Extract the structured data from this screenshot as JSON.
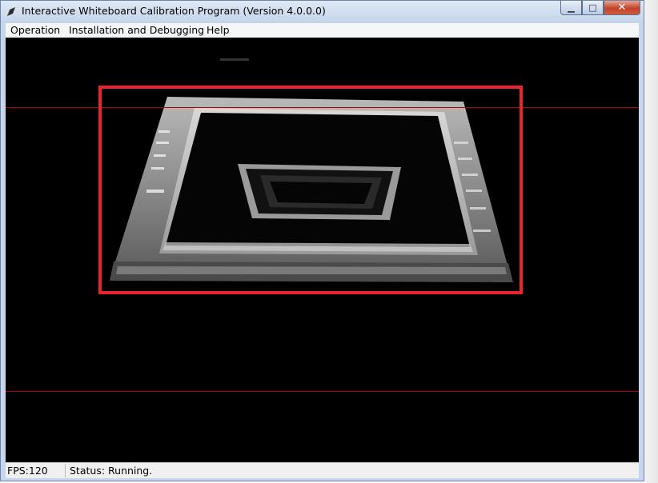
{
  "window": {
    "title": "Interactive Whiteboard Calibration Program (Version 4.0.0.0)",
    "icon": "pen-app-icon"
  },
  "menu": [
    "Operation",
    "Installation and Debugging",
    "Help"
  ],
  "status": {
    "fps": "FPS:120",
    "status_text": "Status: Running."
  },
  "colors": {
    "calibration_rect": "#e8242c",
    "guide_lines": "#b00000",
    "viewport_bg": "#000000"
  }
}
